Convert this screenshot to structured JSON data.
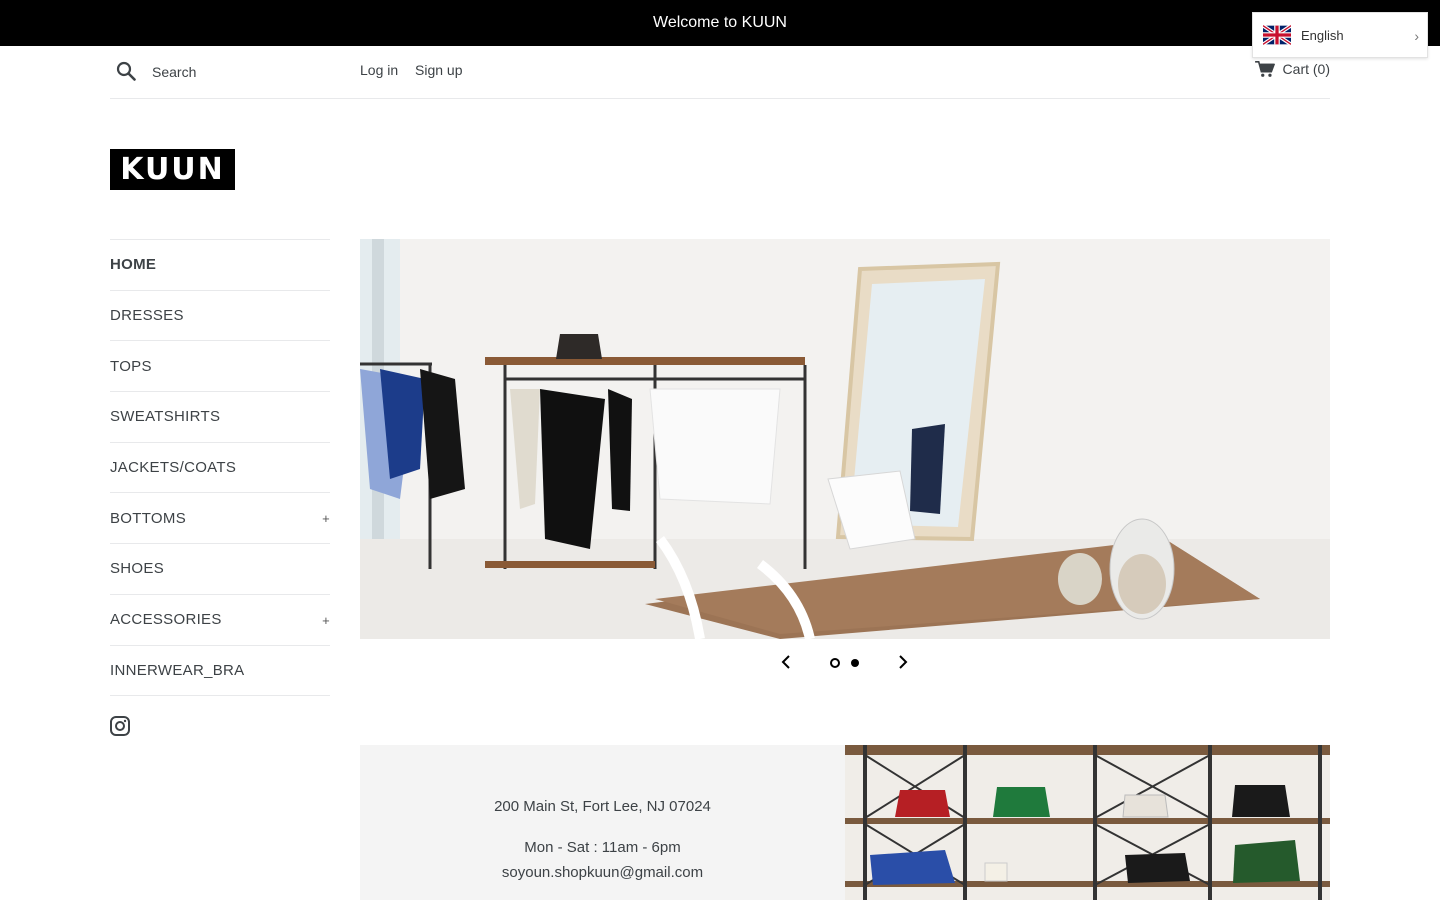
{
  "announcement": {
    "text": "Welcome to KUUN"
  },
  "language": {
    "selected": "English"
  },
  "header": {
    "search_placeholder": "Search",
    "login": "Log in",
    "signup": "Sign up",
    "cart": "Cart (0)"
  },
  "logo": {
    "text": "KUUN"
  },
  "sidebar": {
    "items": [
      {
        "label": "HOME",
        "active": true,
        "expandable": false
      },
      {
        "label": "DRESSES",
        "active": false,
        "expandable": false
      },
      {
        "label": "TOPS",
        "active": false,
        "expandable": false
      },
      {
        "label": "SWEATSHIRTS",
        "active": false,
        "expandable": false
      },
      {
        "label": "JACKETS/COATS",
        "active": false,
        "expandable": false
      },
      {
        "label": "BOTTOMS",
        "active": false,
        "expandable": true
      },
      {
        "label": "SHOES",
        "active": false,
        "expandable": false
      },
      {
        "label": "ACCESSORIES",
        "active": false,
        "expandable": true
      },
      {
        "label": "INNERWEAR_BRA",
        "active": false,
        "expandable": false
      }
    ],
    "expand_symbol": "+",
    "social_icon": "instagram-icon"
  },
  "slideshow": {
    "slide_count": 2,
    "current_slide": 1
  },
  "store_info": {
    "address": "200 Main St, Fort Lee, NJ 07024",
    "hours": "Mon - Sat : 11am - 6pm",
    "email": "soyoun.shopkuun@gmail.com"
  },
  "colors": {
    "announcement_bg": "#000000",
    "text": "#3d4246",
    "info_bg": "#f4f4f4",
    "divider": "#e8e9eb"
  }
}
